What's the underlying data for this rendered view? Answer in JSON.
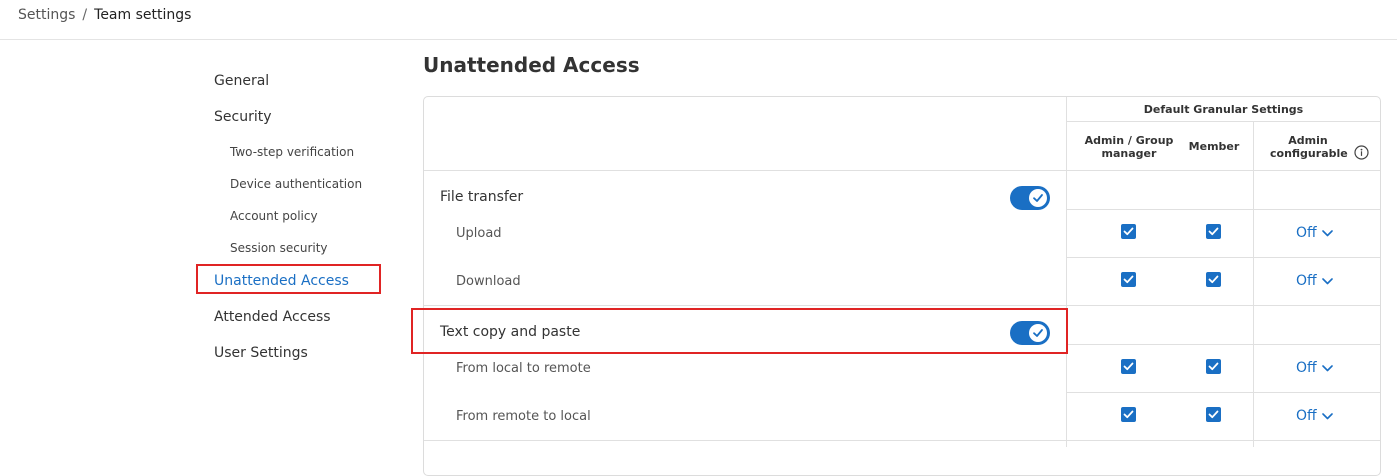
{
  "breadcrumb": {
    "root": "Settings",
    "separator": "/",
    "current": "Team settings"
  },
  "sidebar": {
    "items": [
      {
        "label": "General"
      },
      {
        "label": "Security"
      },
      {
        "label": "Two-step verification"
      },
      {
        "label": "Device authentication"
      },
      {
        "label": "Account policy"
      },
      {
        "label": "Session security"
      },
      {
        "label": "Unattended Access",
        "active": true
      },
      {
        "label": "Attended Access"
      },
      {
        "label": "User Settings"
      }
    ]
  },
  "main": {
    "title": "Unattended Access",
    "table": {
      "group_header": "Default Granular Settings",
      "columns": {
        "admin": "Admin / Group manager",
        "member": "Member",
        "admin_configurable": "Admin configurable"
      },
      "rows": [
        {
          "label": "File transfer",
          "toggle": true
        },
        {
          "label": "Upload",
          "admin": true,
          "member": true,
          "configurable": "Off"
        },
        {
          "label": "Download",
          "admin": true,
          "member": true,
          "configurable": "Off"
        },
        {
          "label": "Text copy and paste",
          "toggle": true
        },
        {
          "label": "From local to remote",
          "admin": true,
          "member": true,
          "configurable": "Off"
        },
        {
          "label": "From remote to local",
          "admin": true,
          "member": true,
          "configurable": "Off"
        }
      ]
    }
  },
  "colors": {
    "accent": "#1a6fc4",
    "highlight": "#e02424"
  },
  "icons": [
    "info-icon",
    "check-icon",
    "chevron-down-icon"
  ]
}
